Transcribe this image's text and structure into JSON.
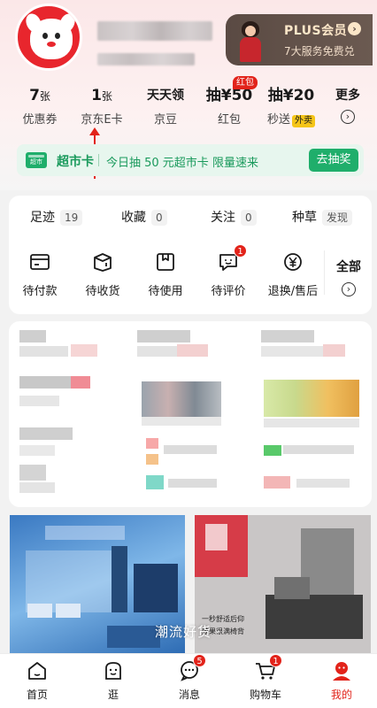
{
  "plus": {
    "title": "PLUS会员",
    "arrow": "›",
    "subtitle": "7大服务免费兑"
  },
  "assets": [
    {
      "value": "7",
      "unit": "张",
      "label": "优惠券"
    },
    {
      "value": "1",
      "unit": "张",
      "label": "京东E卡"
    },
    {
      "value": "天天领",
      "unit": "",
      "label": "京豆"
    },
    {
      "value": "抽¥50",
      "unit": "",
      "label": "红包",
      "tag": "红包"
    },
    {
      "value": "抽¥20",
      "unit": "",
      "label": "秒送",
      "tag": "外卖"
    },
    {
      "value": "更多",
      "unit": "",
      "label": "›"
    }
  ],
  "market": {
    "icon_label": "超市",
    "title": "超市卡",
    "text": "今日抽 50 元超市卡 限量速来",
    "button": "去抽奖"
  },
  "follow": [
    {
      "label": "足迹",
      "count": "19"
    },
    {
      "label": "收藏",
      "count": "0"
    },
    {
      "label": "关注",
      "count": "0"
    },
    {
      "label": "种草",
      "count": "发现"
    }
  ],
  "orders": [
    {
      "label": "待付款",
      "icon": "wallet-icon"
    },
    {
      "label": "待收货",
      "icon": "package-icon"
    },
    {
      "label": "待使用",
      "icon": "ticket-icon"
    },
    {
      "label": "待评价",
      "icon": "comment-icon",
      "badge": "1"
    },
    {
      "label": "退换/售后",
      "icon": "refund-icon"
    }
  ],
  "orders_all": {
    "label": "全部",
    "arrow": "›"
  },
  "banner": {
    "overlay_text": "潮流好货",
    "chevron": "⌄",
    "small_text_1": "一秒舒适后仰",
    "small_text_2": "效果很满椅背"
  },
  "tabs": [
    {
      "label": "首页",
      "icon": "home-icon"
    },
    {
      "label": "逛",
      "icon": "browse-icon"
    },
    {
      "label": "消息",
      "icon": "message-icon",
      "badge": "5"
    },
    {
      "label": "购物车",
      "icon": "cart-icon",
      "badge": "1"
    },
    {
      "label": "我的",
      "icon": "profile-icon",
      "active": true
    }
  ],
  "colors": {
    "brand_red": "#e2231a",
    "market_green": "#1fae6b",
    "plus_brown": "#5a4a43"
  }
}
